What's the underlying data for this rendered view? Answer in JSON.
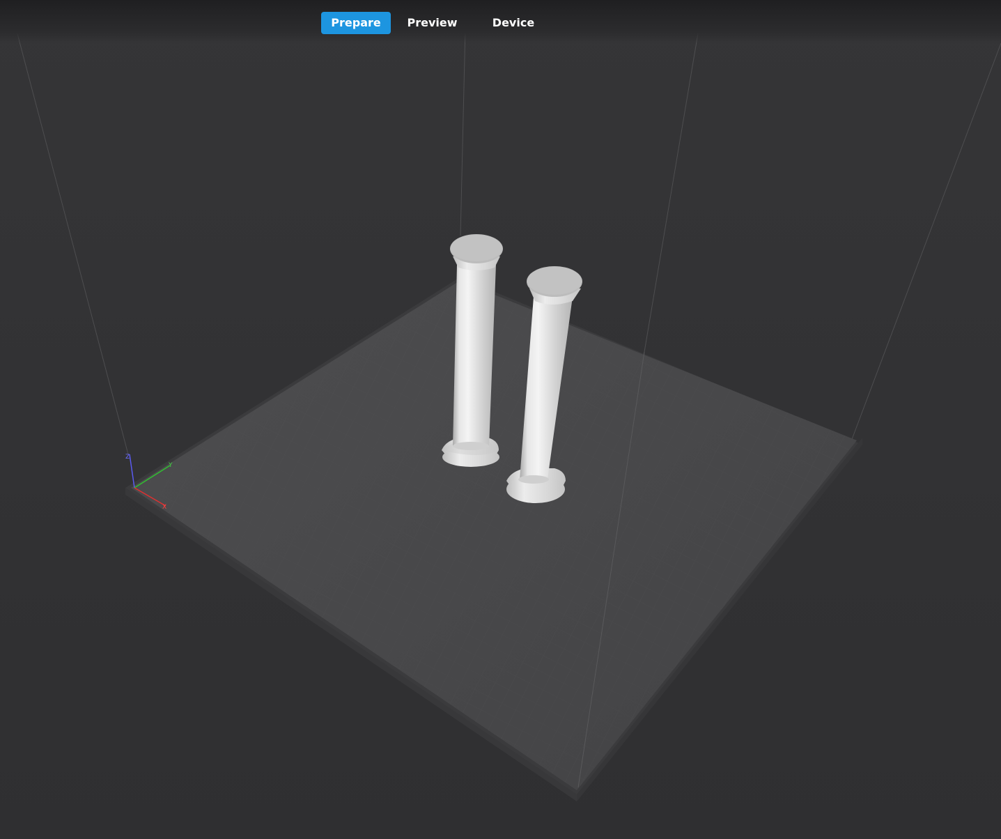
{
  "tabs": [
    {
      "label": "Prepare",
      "active": true
    },
    {
      "label": "Preview",
      "active": false
    },
    {
      "label": "Device",
      "active": false
    }
  ],
  "axes": {
    "x_label": "X",
    "y_label": "Y",
    "z_label": "Z"
  },
  "colors": {
    "accent": "#1d95e0",
    "background": "#333335",
    "plate": "#4a4a4c",
    "model": "#d9d9d9",
    "axis_x": "#e03030",
    "axis_y": "#30c030",
    "axis_z": "#5050e0"
  },
  "scene": {
    "models": [
      "pillar-model-left",
      "pillar-model-right"
    ]
  }
}
